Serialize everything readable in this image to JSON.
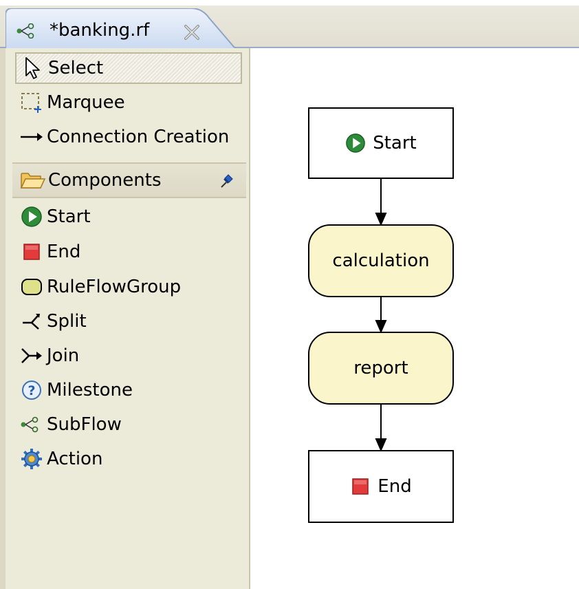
{
  "editor": {
    "tab_title": "*banking.rf",
    "tab_icon": "subflow-icon",
    "close_icon": "close-icon"
  },
  "palette": {
    "tools": [
      {
        "label": "Select",
        "icon": "arrow-pointer-icon",
        "selected": true
      },
      {
        "label": "Marquee",
        "icon": "marquee-icon"
      },
      {
        "label": "Connection Creation",
        "icon": "connection-arrow-icon"
      }
    ],
    "drawer": {
      "label": "Components",
      "icon": "folder-open-icon",
      "pin_icon": "pin-icon"
    },
    "components": [
      {
        "label": "Start",
        "icon": "start-icon"
      },
      {
        "label": "End",
        "icon": "end-icon"
      },
      {
        "label": "RuleFlowGroup",
        "icon": "ruleflowgroup-icon"
      },
      {
        "label": "Split",
        "icon": "split-icon"
      },
      {
        "label": "Join",
        "icon": "join-icon"
      },
      {
        "label": "Milestone",
        "icon": "milestone-icon"
      },
      {
        "label": "SubFlow",
        "icon": "subflow-icon"
      },
      {
        "label": "Action",
        "icon": "action-gear-icon"
      }
    ]
  },
  "diagram": {
    "nodes": [
      {
        "id": "start",
        "label": "Start",
        "kind": "start"
      },
      {
        "id": "calculation",
        "label": "calculation",
        "kind": "ruleflowgroup"
      },
      {
        "id": "report",
        "label": "report",
        "kind": "ruleflowgroup"
      },
      {
        "id": "end",
        "label": "End",
        "kind": "end"
      }
    ],
    "connections": [
      [
        "start",
        "calculation"
      ],
      [
        "calculation",
        "report"
      ],
      [
        "report",
        "end"
      ]
    ]
  },
  "colors": {
    "palette_bg": "#ecead9",
    "group_fill": "#fbf5cc",
    "start_green": "#2e8b3a",
    "end_red": "#e23b3b"
  }
}
